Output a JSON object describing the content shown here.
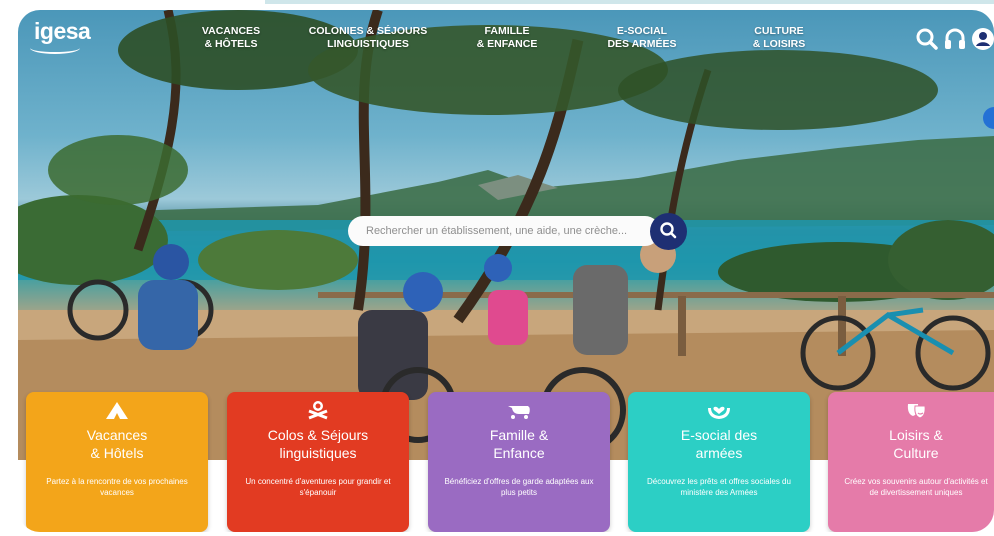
{
  "brand": {
    "logo_text": "igesa"
  },
  "nav": {
    "items": [
      {
        "label": "VACANCES\n& HÔTELS"
      },
      {
        "label": "COLONIES & SÉJOURS\nLINGUISTIQUES"
      },
      {
        "label": "FAMILLE\n& ENFANCE"
      },
      {
        "label": "E-SOCIAL\nDES ARMÉES"
      },
      {
        "label": "CULTURE\n& LOISIRS"
      }
    ]
  },
  "header_icons": [
    "search-icon",
    "headset-icon",
    "account-icon"
  ],
  "search": {
    "placeholder": "Rechercher un établissement, une aide, une crèche..."
  },
  "cards": [
    {
      "icon": "tent-icon",
      "title": "Vacances\n& Hôtels",
      "desc": "Partez à la rencontre de vos prochaines vacances",
      "color": "#f3a51a"
    },
    {
      "icon": "campfire-icon",
      "title": "Colos & Séjours\nlinguistiques",
      "desc": "Un concentré d'aventures pour grandir et s'épanouir",
      "color": "#e23b22"
    },
    {
      "icon": "stroller-icon",
      "title": "Famille &\nEnfance",
      "desc": "Bénéficiez d'offres de garde adaptées aux plus petits",
      "color": "#9a6bc2"
    },
    {
      "icon": "heart-hands-icon",
      "title": "E-social des\narmées",
      "desc": "Découvrez les prêts et offres sociales du ministère des Armées",
      "color": "#2ccfc5"
    },
    {
      "icon": "theatre-masks-icon",
      "title": "Loisirs &\nCulture",
      "desc": "Créez vos souvenirs autour d'activités et de divertissement uniques",
      "color": "#e57ba9"
    }
  ]
}
